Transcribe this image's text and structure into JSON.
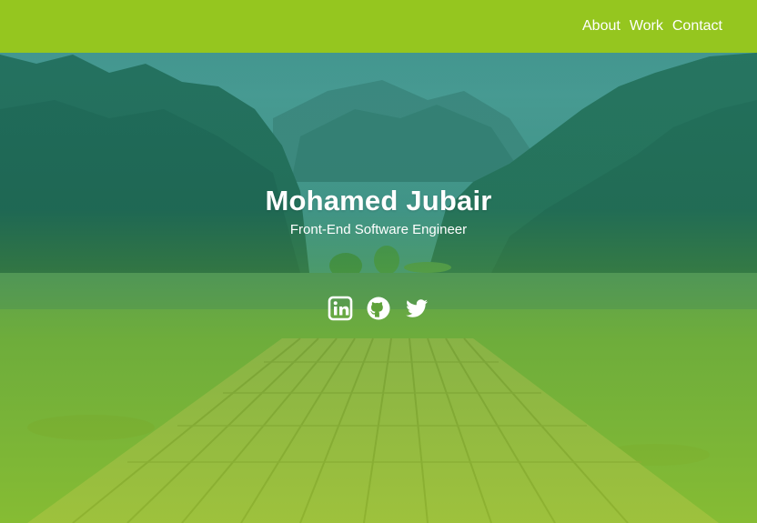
{
  "nav": {
    "links": [
      {
        "label": "About"
      },
      {
        "label": "Work"
      },
      {
        "label": "Contact"
      }
    ]
  },
  "hero": {
    "name": "Mohamed Jubair",
    "role": "Front-End Software Engineer",
    "socials": [
      {
        "icon": "linkedin-icon"
      },
      {
        "icon": "github-icon"
      },
      {
        "icon": "twitter-icon"
      }
    ]
  },
  "colors": {
    "navbar": "#95c61f",
    "text": "#ffffff",
    "overlay_top": "#2a8a7a",
    "overlay_bottom": "#9cc82a"
  }
}
